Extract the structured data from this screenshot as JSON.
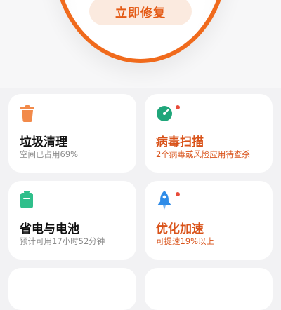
{
  "hero": {
    "fix_button": "立即修复"
  },
  "cards": [
    {
      "title": "垃圾清理",
      "subtitle": "空间已占用69%",
      "icon": "trash-can-icon",
      "icon_color": "#f28a4a",
      "alert": false
    },
    {
      "title": "病毒扫描",
      "subtitle": "2个病毒或风险应用待查杀",
      "icon": "scanner-icon",
      "icon_color": "#1fa67a",
      "alert": true
    },
    {
      "title": "省电与电池",
      "subtitle": "预计可用17小时52分钟",
      "icon": "battery-icon",
      "icon_color": "#2fbf8b",
      "alert": false
    },
    {
      "title": "优化加速",
      "subtitle": "可提速19%以上",
      "icon": "rocket-icon",
      "icon_color": "#2f8ce8",
      "alert": true
    }
  ],
  "colors": {
    "accent": "#f06a1c",
    "warning_text": "#d9531a",
    "alert_dot": "#e84b3a"
  }
}
